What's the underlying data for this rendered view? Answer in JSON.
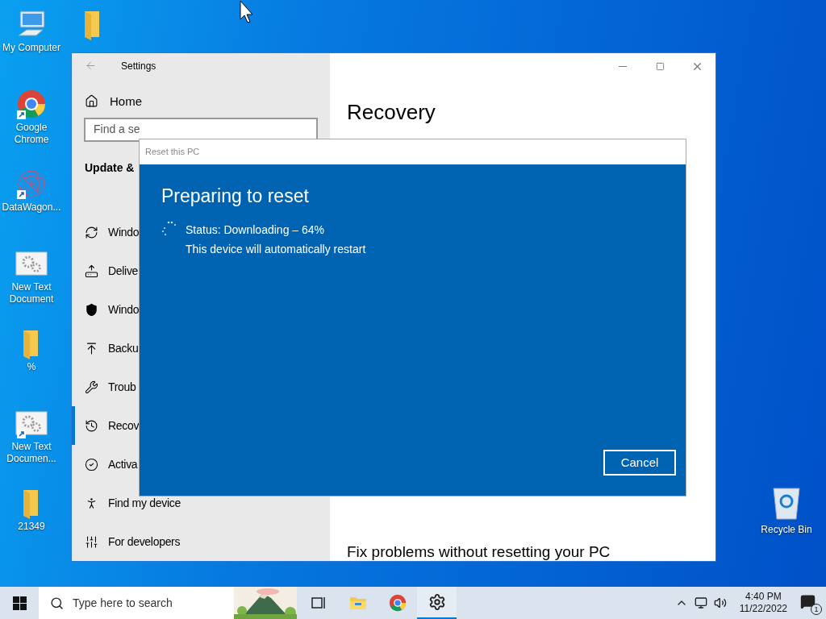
{
  "desktop_icons": [
    {
      "kind": "computer",
      "label": "My Computer",
      "shortcut": false
    },
    {
      "kind": "browser",
      "label": "Google Chrome",
      "shortcut": true
    },
    {
      "kind": "pattern",
      "label": "DataWagon...",
      "shortcut": true
    },
    {
      "kind": "gears",
      "label": "New Text Document",
      "shortcut": false
    },
    {
      "kind": "folder",
      "label": "%",
      "shortcut": false
    },
    {
      "kind": "gears",
      "label": "New Text Documen...",
      "shortcut": true
    },
    {
      "kind": "folder",
      "label": "21349",
      "shortcut": false
    }
  ],
  "second_column_icons": [
    {
      "kind": "folder"
    }
  ],
  "recycle_bin": {
    "label": "Recycle Bin"
  },
  "settings_window": {
    "title": "Settings",
    "home": "Home",
    "search": {
      "placeholder": "Find a se"
    },
    "section": "Update &",
    "nav_items": [
      {
        "kind": "sync",
        "label": "Windo",
        "selected": false
      },
      {
        "kind": "delivery",
        "label": "Delive",
        "selected": false
      },
      {
        "kind": "shield",
        "label": "Windo",
        "selected": false
      },
      {
        "kind": "backup",
        "label": "Backu",
        "selected": false
      },
      {
        "kind": "wrench",
        "label": "Troub",
        "selected": false
      },
      {
        "kind": "recovery",
        "label": "Recov",
        "selected": true
      },
      {
        "kind": "check",
        "label": "Activa",
        "selected": false
      },
      {
        "kind": "person",
        "label": "Find my device",
        "selected": false
      },
      {
        "kind": "tools",
        "label": "For developers",
        "selected": false
      }
    ],
    "page_title": "Recovery",
    "subheading": "Fix problems without resetting your PC"
  },
  "dialog": {
    "title": "Reset this PC",
    "heading": "Preparing to reset",
    "status": "Status: Downloading – 64%",
    "note": "This device will automatically restart",
    "button": "Cancel"
  },
  "taskbar": {
    "search_placeholder": "Type here to search",
    "apps": [
      {
        "kind": "task_view",
        "active": false
      },
      {
        "kind": "explorer",
        "active": false
      },
      {
        "kind": "browser",
        "active": false
      },
      {
        "kind": "settings",
        "active": true
      }
    ],
    "time": "4:40 PM",
    "date": "11/22/2022",
    "notification_count": "1"
  }
}
